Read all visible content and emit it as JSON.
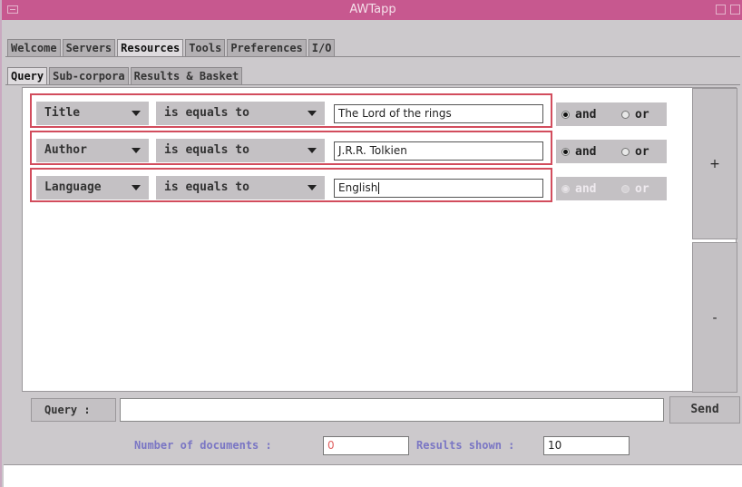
{
  "window": {
    "title": "AWTapp"
  },
  "tabs": [
    "Welcome",
    "Servers",
    "Resources",
    "Tools",
    "Preferences",
    "I/O"
  ],
  "active_tab": "Resources",
  "subtabs": [
    "Query",
    "Sub-corpora",
    "Results & Basket"
  ],
  "active_subtab": "Query",
  "rows": [
    {
      "field": "Title",
      "operator": "is equals to",
      "value": "The Lord of the rings",
      "and": "and",
      "or": "or",
      "selected": "and",
      "enabled": true
    },
    {
      "field": "Author",
      "operator": "is equals to",
      "value": "J.R.R. Tolkien",
      "and": "and",
      "or": "or",
      "selected": "and",
      "enabled": true
    },
    {
      "field": "Language",
      "operator": "is equals to",
      "value": "English",
      "and": "and",
      "or": "or",
      "selected": "and",
      "enabled": false
    }
  ],
  "buttons": {
    "add": "+",
    "remove": "-",
    "send": "Send"
  },
  "query": {
    "label": "Query :",
    "value": ""
  },
  "status": {
    "doc_count_label": "Number of documents :",
    "doc_count_value": "0",
    "results_label": "Results shown :",
    "results_value": "10"
  },
  "colors": {
    "titlebar": "#c7588f",
    "row_border": "#d24d5d",
    "status_label": "#7a76c4",
    "doc_count_value": "#e06060"
  }
}
